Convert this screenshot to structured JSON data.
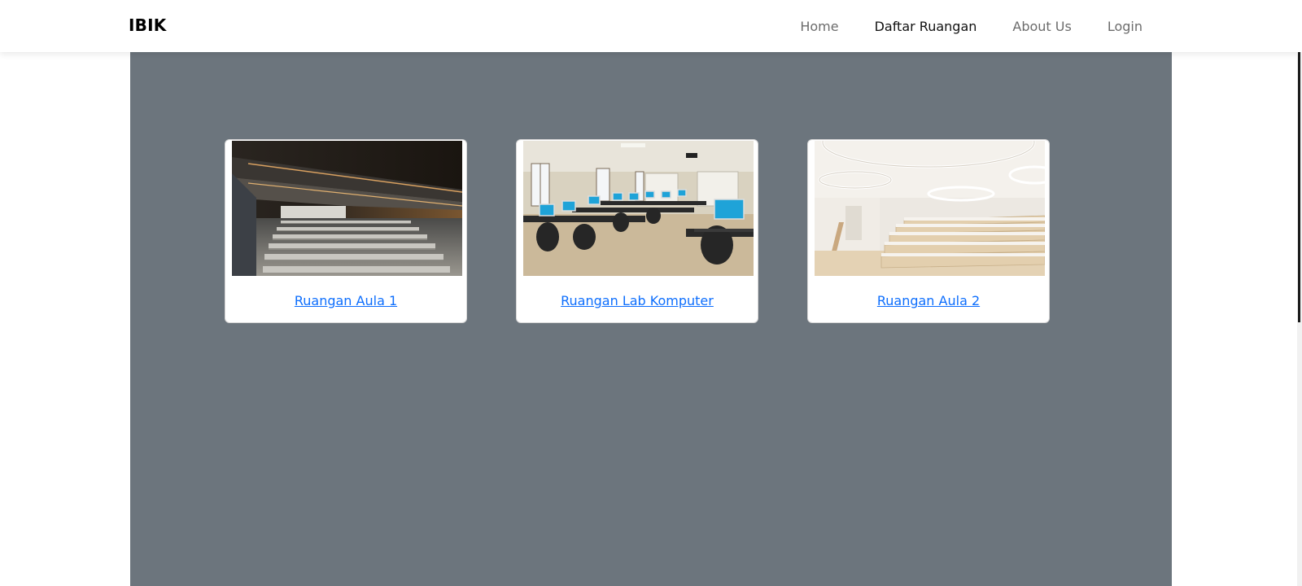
{
  "navbar": {
    "brand": "IBIK",
    "links": [
      {
        "label": "Home",
        "active": false
      },
      {
        "label": "Daftar Ruangan",
        "active": true
      },
      {
        "label": "About Us",
        "active": false
      },
      {
        "label": "Login",
        "active": false
      }
    ]
  },
  "rooms": [
    {
      "label": "Ruangan Aula 1",
      "image": "auditorium-photo"
    },
    {
      "label": "Ruangan Lab Komputer",
      "image": "computer-lab-photo"
    },
    {
      "label": "Ruangan Aula 2",
      "image": "lecture-hall-photo"
    }
  ],
  "colors": {
    "main_background": "#6c757d",
    "link": "#0d6efd",
    "nav_text": "#6c6c6c",
    "nav_active": "#111111"
  }
}
